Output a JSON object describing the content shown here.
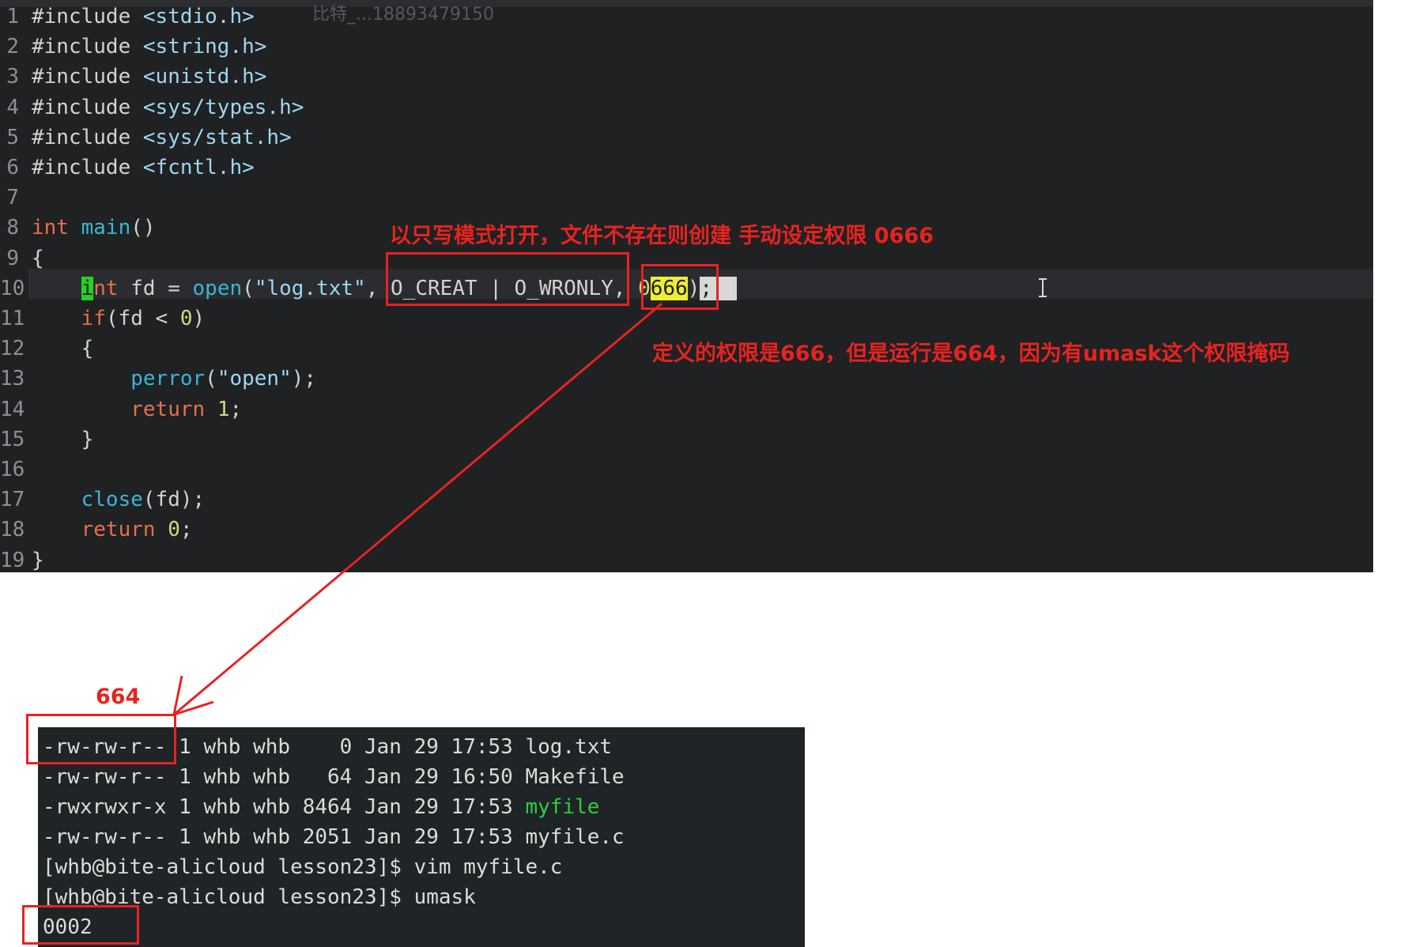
{
  "editor": {
    "ghost_text": "比特_...18893479150",
    "lines": [
      {
        "no": "1",
        "tokens": [
          [
            "pp",
            "#include "
          ],
          [
            "str",
            "<stdio.h>"
          ]
        ]
      },
      {
        "no": "2",
        "tokens": [
          [
            "pp",
            "#include "
          ],
          [
            "str",
            "<string.h>"
          ]
        ]
      },
      {
        "no": "3",
        "tokens": [
          [
            "pp",
            "#include "
          ],
          [
            "str",
            "<unistd.h>"
          ]
        ]
      },
      {
        "no": "4",
        "tokens": [
          [
            "pp",
            "#include "
          ],
          [
            "str",
            "<sys/types.h>"
          ]
        ]
      },
      {
        "no": "5",
        "tokens": [
          [
            "pp",
            "#include "
          ],
          [
            "str",
            "<sys/stat.h>"
          ]
        ]
      },
      {
        "no": "6",
        "tokens": [
          [
            "pp",
            "#include "
          ],
          [
            "str",
            "<fcntl.h>"
          ]
        ]
      },
      {
        "no": "7",
        "tokens": []
      },
      {
        "no": "8",
        "tokens": [
          [
            "kw",
            "int "
          ],
          [
            "fn",
            "main"
          ],
          [
            "pp",
            "()"
          ]
        ]
      },
      {
        "no": "9",
        "tokens": [
          [
            "pp",
            "{"
          ]
        ]
      },
      {
        "no": "10",
        "tokens": [
          [
            "pp",
            "    "
          ],
          [
            "hl-cursor",
            "i"
          ],
          [
            "kw",
            "nt "
          ],
          [
            "pp",
            "fd = "
          ],
          [
            "fn",
            "open"
          ],
          [
            "pp",
            "("
          ],
          [
            "str",
            "\"log.txt\""
          ],
          [
            "pp",
            ", O_CREAT | O_WRONLY, "
          ],
          [
            "num",
            "0"
          ],
          [
            "hl-yellow",
            "666"
          ],
          [
            "pp",
            ")"
          ],
          [
            "sel",
            ";  "
          ]
        ]
      },
      {
        "no": "11",
        "tokens": [
          [
            "pp",
            "    "
          ],
          [
            "kw",
            "if"
          ],
          [
            "pp",
            "(fd < "
          ],
          [
            "num",
            "0"
          ],
          [
            "pp",
            ")"
          ]
        ]
      },
      {
        "no": "12",
        "tokens": [
          [
            "pp",
            "    {"
          ]
        ]
      },
      {
        "no": "13",
        "tokens": [
          [
            "pp",
            "        "
          ],
          [
            "fn",
            "perror"
          ],
          [
            "pp",
            "("
          ],
          [
            "str",
            "\"open\""
          ],
          [
            "pp",
            ");"
          ]
        ]
      },
      {
        "no": "14",
        "tokens": [
          [
            "pp",
            "        "
          ],
          [
            "kw",
            "return "
          ],
          [
            "num",
            "1"
          ],
          [
            "pp",
            ";"
          ]
        ]
      },
      {
        "no": "15",
        "tokens": [
          [
            "pp",
            "    }"
          ]
        ]
      },
      {
        "no": "16",
        "tokens": []
      },
      {
        "no": "17",
        "tokens": [
          [
            "pp",
            "    "
          ],
          [
            "fn",
            "close"
          ],
          [
            "pp",
            "(fd);"
          ]
        ]
      },
      {
        "no": "18",
        "tokens": [
          [
            "pp",
            "    "
          ],
          [
            "kw",
            "return "
          ],
          [
            "num",
            "0"
          ],
          [
            "pp",
            ";"
          ]
        ]
      },
      {
        "no": "19",
        "tokens": [
          [
            "pp",
            "}"
          ]
        ]
      }
    ]
  },
  "terminal": {
    "lines": [
      [
        [
          "",
          "-rw-rw-r-- 1 whb whb    0 Jan 29 17:53 log.txt"
        ]
      ],
      [
        [
          "",
          "-rw-rw-r-- 1 whb whb   64 Jan 29 16:50 Makefile"
        ]
      ],
      [
        [
          "",
          "-rwxrwxr-x 1 whb whb 8464 Jan 29 17:53 "
        ],
        [
          "green",
          "myfile"
        ]
      ],
      [
        [
          "",
          "-rw-rw-r-- 1 whb whb 2051 Jan 29 17:53 myfile.c"
        ]
      ],
      [
        [
          "",
          "[whb@bite-alicloud lesson23]$ vim myfile.c"
        ]
      ],
      [
        [
          "",
          "[whb@bite-alicloud lesson23]$ umask"
        ]
      ],
      [
        [
          "",
          "0002"
        ]
      ]
    ]
  },
  "annotations": {
    "open_flags": "以只写模式打开，文件不存在则创建 手动设定权限 0666",
    "umask_note": "定义的权限是666，但是运行是664，因为有umask这个权限掩码",
    "result_perm": "664"
  },
  "colors": {
    "annotation_red": "#e8231f",
    "editor_bg": "#1f2123",
    "terminal_bg": "#1f2426"
  }
}
